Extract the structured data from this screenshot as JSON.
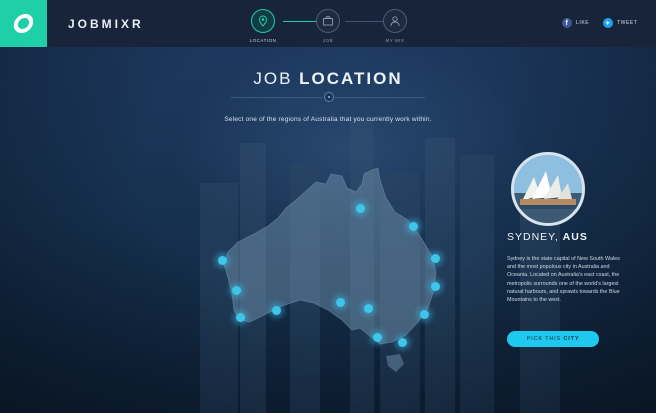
{
  "header": {
    "brand": "JOBMIXR",
    "steps": [
      {
        "label": "LOCATION",
        "icon": "map-pin-icon",
        "active": true
      },
      {
        "label": "JOB",
        "icon": "briefcase-icon",
        "active": false
      },
      {
        "label": "MY MIX",
        "icon": "user-icon",
        "active": false
      }
    ],
    "social": {
      "like": "LIKE",
      "tweet": "TWEET"
    }
  },
  "main": {
    "title_light": "JOB ",
    "title_bold": "LOCATION",
    "subtitle": "Select one of the regions of Australia that you currently work within."
  },
  "panel": {
    "city": "SYDNEY, ",
    "country": "AUS",
    "description": "Sydney is the state capital of New South Wales and the most populous city in Australia and Oceania. Located on Australia's east coast, the metropolis surrounds one of the world's largest natural harbours, and sprawls towards the Blue Mountains to the west.",
    "button_light": "PICK THIS ",
    "button_bold": "CITY"
  },
  "colors": {
    "accent": "#1fcfa8",
    "pin": "#3fc4ea",
    "button": "#1dc9ec",
    "header": "#18243a"
  }
}
